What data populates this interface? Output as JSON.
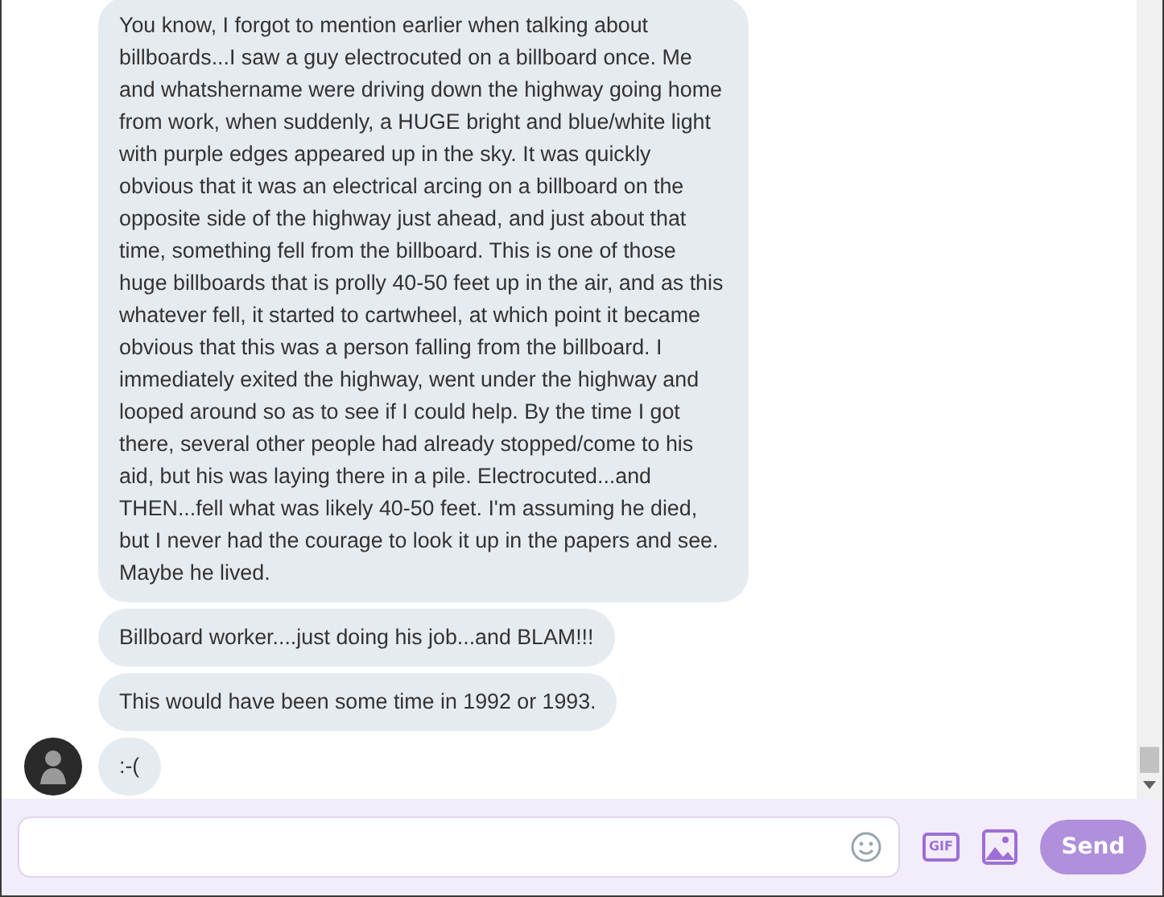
{
  "messages": [
    {
      "text": "You know, I forgot to mention earlier when talking about billboards...I saw a guy electrocuted on a billboard once. Me and whatshername were driving down the highway going home from work, when suddenly, a HUGE bright and blue/white light with purple edges appeared up in the sky. It was quickly obvious that it was an electrical arcing on a billboard on the opposite side of the highway just ahead, and just about that time, something fell from the billboard. This is one of those huge billboards that is prolly 40-50 feet up in the air, and as this whatever fell, it started to cartwheel, at which point it became obvious that this was a person falling from the billboard. I immediately exited the highway, went under the highway and looped around so as to see if I could help. By the time I got there, several other people had already stopped/come to his aid, but his was laying there in a pile. Electrocuted...and THEN...fell what was likely 40-50 feet. I'm assuming he died, but I never had the courage to look it up in the papers and see. Maybe he lived.",
      "avatar": false
    },
    {
      "text": "Billboard worker....just doing his job...and BLAM!!!",
      "avatar": false
    },
    {
      "text": "This would have been some time in 1992 or 1993.",
      "avatar": false
    },
    {
      "text": ":-(",
      "avatar": true
    }
  ],
  "composer": {
    "gif_label": "GIF",
    "send_button": {
      "label": "Send",
      "disabled": true
    }
  }
}
